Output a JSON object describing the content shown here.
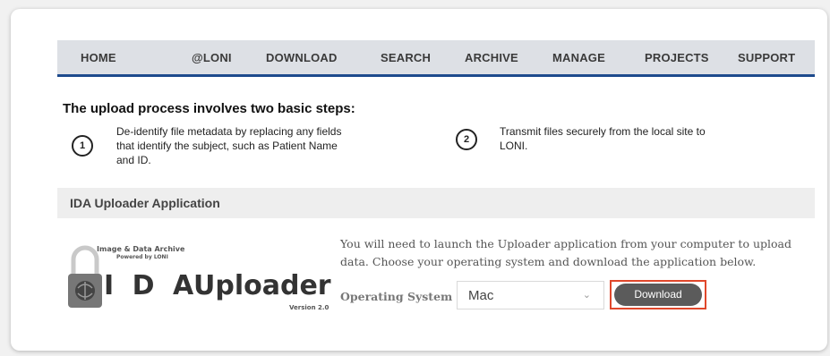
{
  "nav": {
    "items": [
      "HOME",
      "@LONI",
      "DOWNLOAD",
      "SEARCH",
      "ARCHIVE",
      "MANAGE",
      "PROJECTS",
      "SUPPORT"
    ]
  },
  "upload": {
    "title": "The upload process involves two basic steps:",
    "steps": [
      {
        "number": "1",
        "line1": "De-identify file metadata by replacing any fields",
        "line2": "that identify the subject, such as Patient Name",
        "line3": "and ID."
      },
      {
        "number": "2",
        "line1": "Transmit files securely from the local site to",
        "line2": "LONI."
      }
    ]
  },
  "section": {
    "title": "IDA Uploader Application"
  },
  "logo": {
    "line1": "Image & Data Archive",
    "line2": "Powered by LONI",
    "brand": "I D A",
    "product": "Uploader",
    "version": "Version 2.0"
  },
  "description": {
    "line1": "You will need to launch the Uploader application from your computer to upload",
    "line2": "data. Choose your operating system and download the application below."
  },
  "os": {
    "label": "Operating System",
    "value": "Mac"
  },
  "download": {
    "label": "Download"
  },
  "colors": {
    "nav_underline": "#1d4a8c",
    "button": "#5b5b5b",
    "highlight": "#e0472b"
  }
}
